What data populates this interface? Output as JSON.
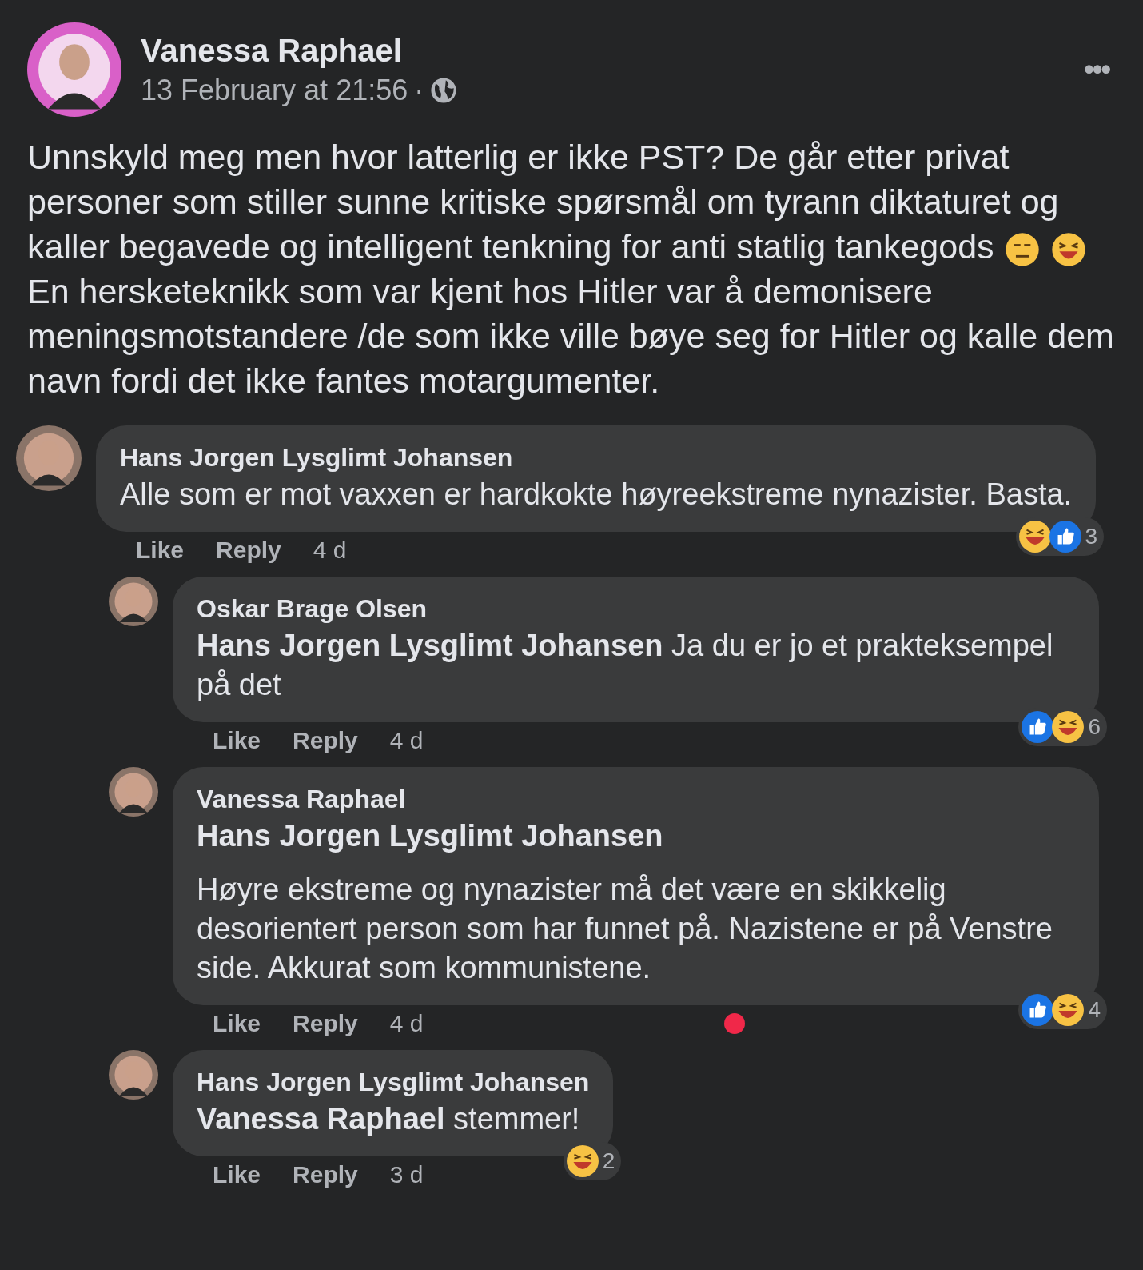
{
  "post": {
    "author": "Vanessa Raphael",
    "time": "13 February at 21:56",
    "separator": "·",
    "more": "•••",
    "paragraphs": [
      {
        "kind": "with_emoji",
        "text": "Unnskyld meg men hvor latterlig er ikke PST? De går etter privat personer som stiller sunne kritiske spørsmål om tyrann diktaturet og kaller begavede og intelligent tenkning for anti statlig tankegods"
      },
      {
        "kind": "plain",
        "text": "En hersketeknikk som var kjent hos Hitler var å demonisere meningsmotstandere /de som ikke ville bøye seg for Hitler og kalle dem navn fordi det ikke fantes motargumenter."
      }
    ]
  },
  "comments": [
    {
      "author": "Hans Jorgen Lysglimt Johansen",
      "body": [
        {
          "kind": "text",
          "text": "Alle som er mot vaxxen er hardkokte høyreekstreme nynazister. Basta."
        }
      ],
      "actions": [
        "Like",
        "Reply",
        "4 d"
      ],
      "reactions": [
        {
          "kind": "haha"
        },
        {
          "kind": "like"
        }
      ],
      "count": "3",
      "marked": false,
      "children": [
        {
          "author": "Oskar Brage Olsen",
          "body": [
            {
              "kind": "text",
              "text": "**Hans Jorgen Lysglimt Johansen** Ja du er jo et prakteksempel på det"
            }
          ],
          "actions": [
            "Like",
            "Reply",
            "4 d"
          ],
          "reactions": [
            {
              "kind": "like"
            },
            {
              "kind": "haha"
            }
          ],
          "count": "6",
          "marked": false
        },
        {
          "author": "Vanessa Raphael",
          "body": [
            {
              "kind": "mention",
              "text": "Hans Jorgen Lysglimt Johansen"
            },
            {
              "kind": "text",
              "text": "Høyre ekstreme og nynazister må det være en skikkelig desorientert person som har funnet på. Nazistene er på Venstre side. Akkurat som kommunistene."
            }
          ],
          "actions": [
            "Like",
            "Reply",
            "4 d"
          ],
          "reactions": [
            {
              "kind": "like"
            },
            {
              "kind": "haha"
            }
          ],
          "count": "4",
          "marked": true
        },
        {
          "author": "Hans Jorgen Lysglimt Johansen",
          "body": [
            {
              "kind": "text",
              "text": "**Vanessa Raphael** stemmer!"
            }
          ],
          "actions": [
            "Like",
            "Reply",
            "3 d"
          ],
          "reactions": [
            {
              "kind": "haha"
            }
          ],
          "count": "2",
          "marked": false
        }
      ]
    }
  ]
}
